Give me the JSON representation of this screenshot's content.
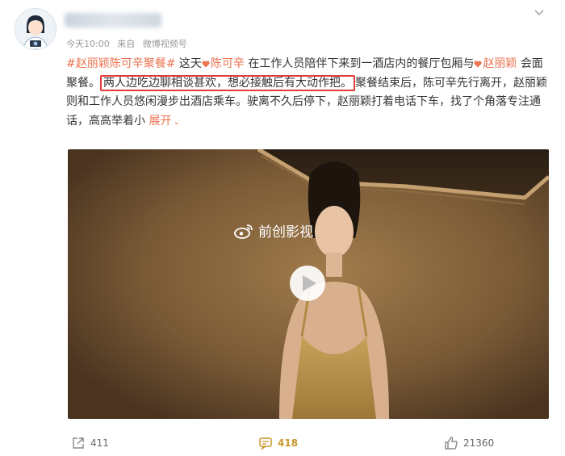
{
  "post": {
    "meta": {
      "time": "今天10:00",
      "from_label": "来自",
      "source": "微博视频号"
    },
    "text": {
      "hashtag": "#赵丽颖陈可辛聚餐#",
      "part1": "这天",
      "mention1": "陈可辛",
      "part2": "在工作人员陪伴下来到一酒店内的餐厅包厢与",
      "mention2": "赵丽颖",
      "part3": "会面聚餐。",
      "highlighted": "两人边吃边聊相谈甚欢，想必接触后有大动作把。",
      "part4": "聚餐结束后，陈可辛先行离开，赵丽颖则和工作人员悠闲漫步出酒店乘车。驶离不久后停下，赵丽颖打着电话下车，找了个角落专注通话，高高举着小",
      "expand_label": "展开"
    },
    "media": {
      "watermark": "前创影视"
    },
    "actions": {
      "share_count": "411",
      "comment_count": "418",
      "like_count": "21360"
    }
  },
  "colors": {
    "accent": "#eb7350",
    "highlight_border": "#e53935",
    "comment_count": "#c8962a"
  },
  "icons": [
    "avatar-illustration",
    "chevron-down-icon",
    "heart-icon",
    "weibo-logo-icon",
    "play-icon",
    "share-icon",
    "comment-icon",
    "like-icon"
  ]
}
